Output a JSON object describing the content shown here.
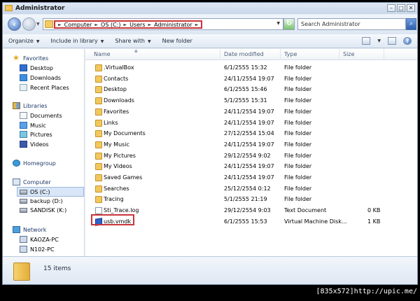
{
  "window": {
    "title": "Administrator"
  },
  "address": {
    "crumbs": [
      "Computer",
      "OS (C:)",
      "Users",
      "Administrator"
    ],
    "search_placeholder": "Search Administrator"
  },
  "toolbar": {
    "organize": "Organize",
    "include_in_library": "Include in library",
    "share_with": "Share with",
    "new_folder": "New folder"
  },
  "nav": {
    "favorites": {
      "label": "Favorites",
      "items": [
        "Desktop",
        "Downloads",
        "Recent Places"
      ]
    },
    "libraries": {
      "label": "Libraries",
      "items": [
        "Documents",
        "Music",
        "Pictures",
        "Videos"
      ]
    },
    "homegroup": "Homegroup",
    "computer": {
      "label": "Computer",
      "items": [
        "OS (C:)",
        "backup (D:)",
        "SANDISK (K:)"
      ]
    },
    "network": {
      "label": "Network",
      "items": [
        "KAOZA-PC",
        "N102-PC"
      ]
    }
  },
  "columns": {
    "name": "Name",
    "date": "Date modified",
    "type": "Type",
    "size": "Size"
  },
  "files": [
    {
      "name": ".VirtualBox",
      "date": "6/1/2555 15:32",
      "type": "File folder",
      "size": "",
      "icon": "folder"
    },
    {
      "name": "Contacts",
      "date": "24/11/2554 19:07",
      "type": "File folder",
      "size": "",
      "icon": "folder"
    },
    {
      "name": "Desktop",
      "date": "6/1/2555 15:46",
      "type": "File folder",
      "size": "",
      "icon": "folder"
    },
    {
      "name": "Downloads",
      "date": "5/1/2555 15:31",
      "type": "File folder",
      "size": "",
      "icon": "folder"
    },
    {
      "name": "Favorites",
      "date": "24/11/2554 19:07",
      "type": "File folder",
      "size": "",
      "icon": "folder"
    },
    {
      "name": "Links",
      "date": "24/11/2554 19:07",
      "type": "File folder",
      "size": "",
      "icon": "folder"
    },
    {
      "name": "My Documents",
      "date": "27/12/2554 15:04",
      "type": "File folder",
      "size": "",
      "icon": "folder"
    },
    {
      "name": "My Music",
      "date": "24/11/2554 19:07",
      "type": "File folder",
      "size": "",
      "icon": "folder"
    },
    {
      "name": "My Pictures",
      "date": "29/12/2554 9:02",
      "type": "File folder",
      "size": "",
      "icon": "folder"
    },
    {
      "name": "My Videos",
      "date": "24/11/2554 19:07",
      "type": "File folder",
      "size": "",
      "icon": "folder"
    },
    {
      "name": "Saved Games",
      "date": "24/11/2554 19:07",
      "type": "File folder",
      "size": "",
      "icon": "folder"
    },
    {
      "name": "Searches",
      "date": "25/12/2554 0:12",
      "type": "File folder",
      "size": "",
      "icon": "folder"
    },
    {
      "name": "Tracing",
      "date": "5/1/2555 21:19",
      "type": "File folder",
      "size": "",
      "icon": "folder"
    },
    {
      "name": "Sti_Trace.log",
      "date": "29/12/2554 9:03",
      "type": "Text Document",
      "size": "0 KB",
      "icon": "file"
    },
    {
      "name": "usb.vmdk",
      "date": "6/1/2555 15:53",
      "type": "Virtual Machine Disk...",
      "size": "1 KB",
      "icon": "vmdk"
    }
  ],
  "status": {
    "count": "15 items"
  },
  "watermark": "[835x572]http://upic.me/"
}
